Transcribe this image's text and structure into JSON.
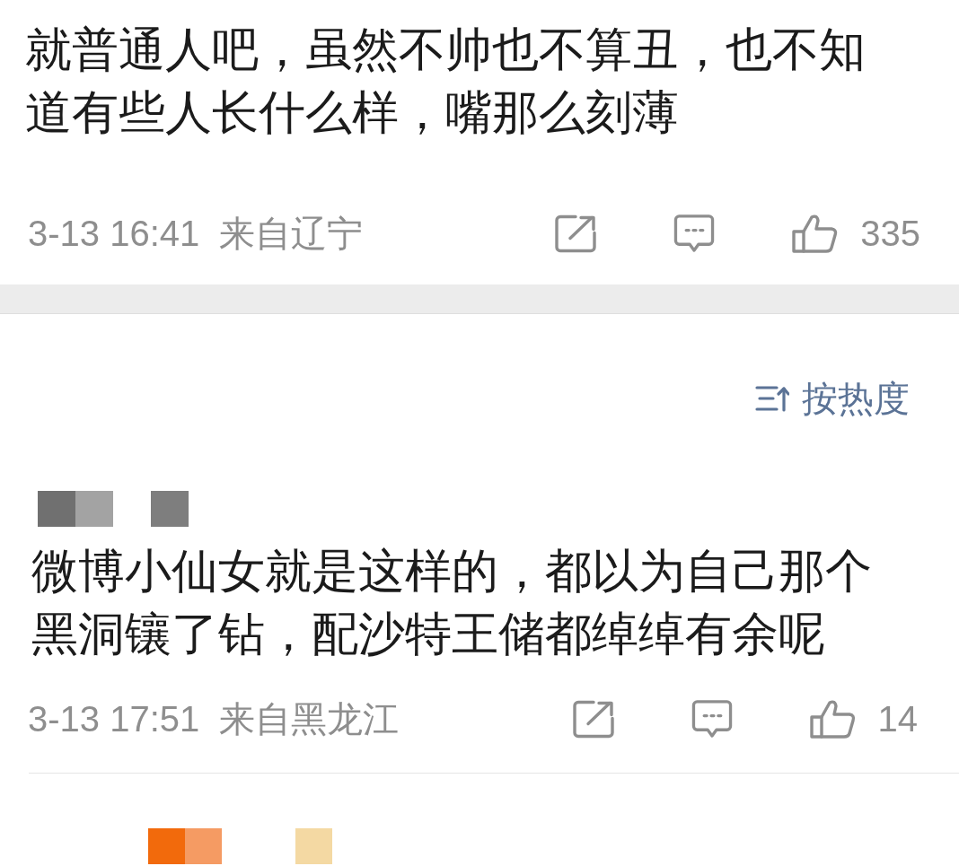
{
  "post": {
    "text": "就普通人吧，虽然不帅也不算丑，也不知道有些人长什么样，嘴那么刻薄",
    "time": "3-13 16:41",
    "location": "来自辽宁",
    "likes": "335"
  },
  "sort": {
    "label": "按热度"
  },
  "comments": [
    {
      "author": {
        "kind": "grey-mosaic"
      },
      "text": "微博小仙女就是这样的，都以为自己那个黑洞镶了钻，配沙特王储都绰绰有余呢",
      "time": "3-13 17:51",
      "location": "来自黑龙江",
      "likes": "14"
    },
    {
      "author": {
        "kind": "orange-mosaic"
      }
    }
  ]
}
